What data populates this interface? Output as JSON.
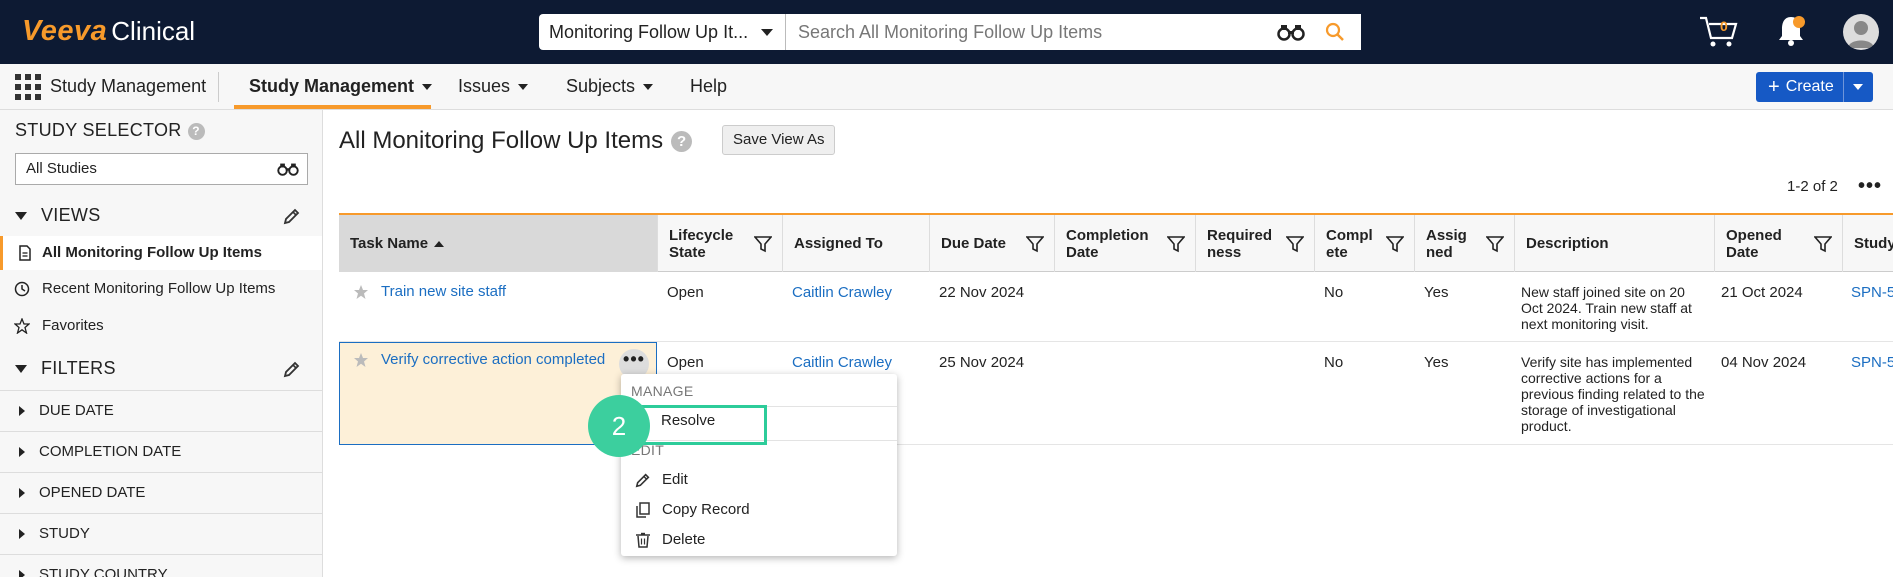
{
  "header": {
    "logo_brand": "Veeva",
    "logo_product": "Clinical",
    "search_scope": "Monitoring Follow Up It...",
    "search_placeholder": "Search All Monitoring Follow Up Items",
    "cart_count": "0",
    "accent_color": "#f79a2b",
    "icons": [
      "binoculars-icon",
      "search-icon",
      "cart-icon",
      "bell-icon",
      "user-avatar-icon"
    ]
  },
  "nav": {
    "app_name": "Study Management",
    "items": [
      {
        "label": "Study Management",
        "active": true,
        "dropdown": true
      },
      {
        "label": "Issues",
        "dropdown": true
      },
      {
        "label": "Subjects",
        "dropdown": true
      },
      {
        "label": "Help",
        "dropdown": false
      }
    ],
    "create_label": "Create"
  },
  "sidebar": {
    "study_selector_title": "STUDY SELECTOR",
    "study_selector_value": "All Studies",
    "views_title": "VIEWS",
    "views": [
      {
        "label": "All Monitoring Follow Up Items",
        "active": true
      },
      {
        "label": "Recent Monitoring Follow Up Items"
      },
      {
        "label": "Favorites"
      }
    ],
    "filters_title": "FILTERS",
    "filters": [
      "DUE DATE",
      "COMPLETION DATE",
      "OPENED DATE",
      "STUDY",
      "STUDY COUNTRY"
    ]
  },
  "main": {
    "title": "All Monitoring Follow Up Items",
    "save_view_label": "Save View As",
    "count_label": "1-2 of 2",
    "columns": [
      {
        "label": "Task Name",
        "sorted": "asc"
      },
      {
        "label": "Lifecycle State"
      },
      {
        "label": "Assigned To"
      },
      {
        "label": "Due Date"
      },
      {
        "label": "Completion Date"
      },
      {
        "label": "Required ness"
      },
      {
        "label": "Compl ete"
      },
      {
        "label": "Assig ned"
      },
      {
        "label": "Description"
      },
      {
        "label": "Opened Date"
      },
      {
        "label": "Study"
      }
    ],
    "rows": [
      {
        "task": "Train new site staff",
        "state": "Open",
        "assigned_to": "Caitlin Crawley",
        "due": "22 Nov 2024",
        "completion": "",
        "requiredness": "",
        "complete": "No",
        "assigned": "Yes",
        "description": "New staff joined site on 20 Oct 2024. Train new staff at next monitoring visit.",
        "opened": "21 Oct 2024",
        "study": "SPN-5"
      },
      {
        "task": "Verify corrective action completed",
        "state": "Open",
        "assigned_to": "Caitlin Crawley",
        "due": "25 Nov 2024",
        "completion": "",
        "requiredness": "",
        "complete": "No",
        "assigned": "Yes",
        "description": "Verify site has implemented corrective actions for a previous finding related to the storage of investigational product.",
        "opened": "04 Nov 2024",
        "study": "SPN-5"
      }
    ]
  },
  "menu": {
    "manage_header": "MANAGE",
    "resolve_label": "Resolve",
    "edit_header": "EDIT",
    "edit_label": "Edit",
    "copy_label": "Copy Record",
    "delete_label": "Delete"
  },
  "annotation": {
    "step_number": "2",
    "highlight_color": "#2dcc9a"
  }
}
